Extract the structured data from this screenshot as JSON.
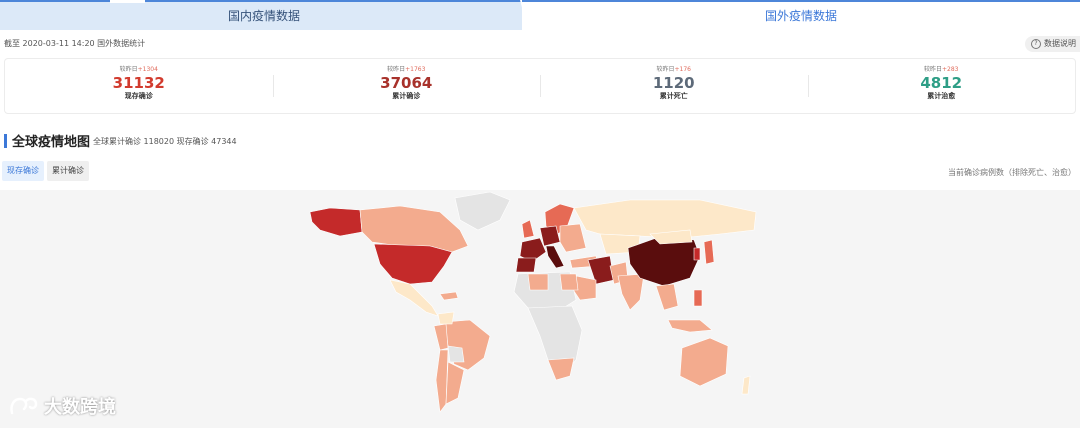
{
  "tabs": [
    {
      "label": "国内疫情数据"
    },
    {
      "label": "国外疫情数据"
    }
  ],
  "update_time": "截至 2020-03-11 14:20 国外数据统计",
  "help_label": "数据说明",
  "stats": [
    {
      "delta_label": "较昨日",
      "delta_value": "+1304",
      "value": "31132",
      "label": "现存确诊",
      "color": "#d23b2e"
    },
    {
      "delta_label": "较昨日",
      "delta_value": "+1763",
      "value": "37064",
      "label": "累计确诊",
      "color": "#a8322b"
    },
    {
      "delta_label": "较昨日",
      "delta_value": "+176",
      "value": "1120",
      "label": "累计死亡",
      "color": "#5d6a79"
    },
    {
      "delta_label": "较昨日",
      "delta_value": "+283",
      "value": "4812",
      "label": "累计治愈",
      "color": "#2e9e86"
    }
  ],
  "map_section": {
    "title": "全球疫情地图",
    "subtitle": "全球累计确诊 118020  现存确诊 47344",
    "tabs": [
      {
        "label": "现存确诊",
        "active": true
      },
      {
        "label": "累计确诊",
        "active": false
      }
    ],
    "legend_note": "当前确诊病例数（排除死亡、治愈）"
  },
  "map_colors": {
    "level1": "#fde8c9",
    "level2": "#f3ab8e",
    "level3": "#e66a55",
    "level4": "#c42a2a",
    "level5": "#8a1c1c",
    "level6": "#5a0d0d",
    "nodata": "#e4e4e4"
  },
  "watermark": "大数跨境"
}
